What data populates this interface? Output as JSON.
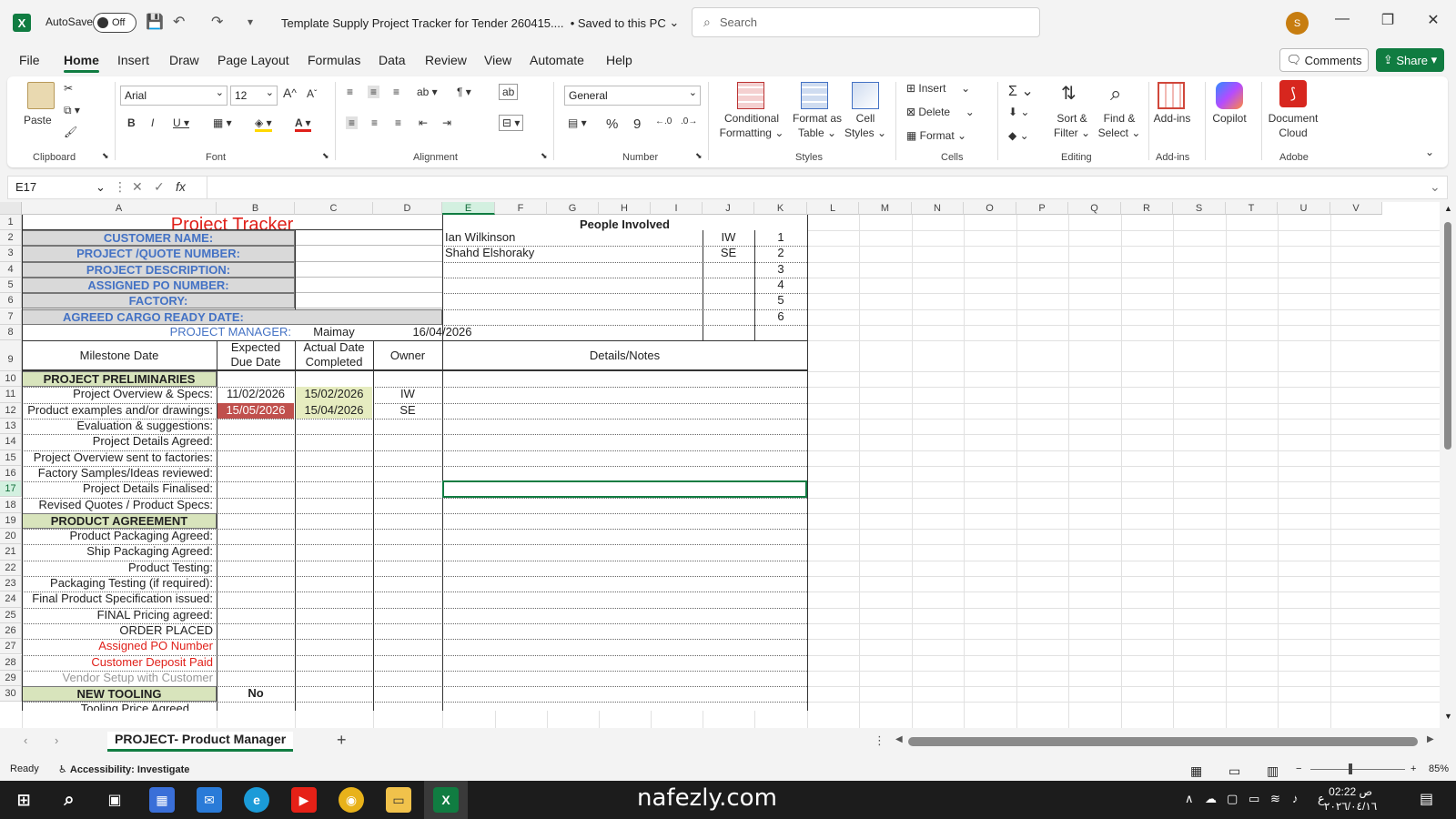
{
  "titlebar": {
    "app_icon": "X",
    "autosave_label": "AutoSave",
    "autosave_state": "Off",
    "doc_title": "Template Supply Project Tracker for Tender 260415....",
    "save_status": "• Saved to this PC",
    "search_placeholder": "Search",
    "user_initial": "S"
  },
  "menu": {
    "tabs": [
      "File",
      "Home",
      "Insert",
      "Draw",
      "Page Layout",
      "Formulas",
      "Data",
      "Review",
      "View",
      "Automate",
      "Help"
    ],
    "active": "Home",
    "comments": "Comments",
    "share": "Share"
  },
  "ribbon": {
    "clipboard": {
      "paste": "Paste",
      "label": "Clipboard"
    },
    "font": {
      "name": "Arial",
      "size": "12",
      "label": "Font"
    },
    "alignment": {
      "label": "Alignment"
    },
    "number": {
      "format": "General",
      "label": "Number"
    },
    "styles": {
      "conditional": "Conditional",
      "conditional2": "Formatting",
      "format_table": "Format as",
      "format_table2": "Table",
      "cell_styles": "Cell",
      "cell_styles2": "Styles",
      "label": "Styles"
    },
    "cells": {
      "insert": "Insert",
      "delete": "Delete",
      "format": "Format",
      "label": "Cells"
    },
    "editing": {
      "sort": "Sort &",
      "sort2": "Filter",
      "find": "Find &",
      "find2": "Select",
      "label": "Editing"
    },
    "addins": {
      "addins": "Add-ins",
      "label": "Add-ins"
    },
    "copilot": {
      "label": "Copilot"
    },
    "adobe": {
      "doc": "Document",
      "doc2": "Cloud",
      "label": "Adobe"
    }
  },
  "formula_bar": {
    "name_box": "E17",
    "fx": "fx",
    "content": ""
  },
  "grid": {
    "columns": [
      "A",
      "B",
      "C",
      "D",
      "E",
      "F",
      "G",
      "H",
      "I",
      "J",
      "K",
      "L",
      "M",
      "N",
      "O",
      "P",
      "Q",
      "R",
      "S",
      "T",
      "U",
      "V"
    ],
    "selected_column": "E",
    "selected_row": "17",
    "rows": [
      "1",
      "2",
      "3",
      "4",
      "5",
      "6",
      "7",
      "8",
      "9",
      "10",
      "11",
      "12",
      "13",
      "14",
      "15",
      "16",
      "17",
      "18",
      "19",
      "20",
      "21",
      "22",
      "23",
      "24",
      "25",
      "26",
      "27",
      "28",
      "29",
      "30"
    ]
  },
  "sheet": {
    "title": "Project Tracker",
    "people_header": "People Involved",
    "people": [
      {
        "name": "Ian Wilkinson",
        "initials": "IW",
        "num": "1"
      },
      {
        "name": "Shahd Elshoraky",
        "initials": "SE",
        "num": "2"
      },
      {
        "name": "",
        "initials": "",
        "num": "3"
      },
      {
        "name": "",
        "initials": "",
        "num": "4"
      },
      {
        "name": "",
        "initials": "",
        "num": "5"
      },
      {
        "name": "",
        "initials": "",
        "num": "6"
      }
    ],
    "labels": {
      "customer": "CUSTOMER NAME:",
      "project_quote": "PROJECT /QUOTE NUMBER:",
      "description": "PROJECT DESCRIPTION:",
      "po": "ASSIGNED PO NUMBER:",
      "factory": "FACTORY:",
      "cargo": "AGREED CARGO READY DATE:",
      "manager": "PROJECT MANAGER:",
      "manager_name": "Maimay",
      "manager_date": "16/04/2026"
    },
    "headers": {
      "milestone": "Milestone Date",
      "expected1": "Expected",
      "expected2": "Due Date",
      "actual1": "Actual Date",
      "actual2": "Completed",
      "owner": "Owner",
      "notes": "Details/Notes"
    },
    "milestones": [
      {
        "label": "PROJECT PRELIMINARIES",
        "kind": "section",
        "due": "",
        "done": "",
        "owner": ""
      },
      {
        "label": "Project Overview & Specs:",
        "kind": "item",
        "due": "11/02/2026",
        "done": "15/02/2026",
        "owner": "IW"
      },
      {
        "label": "Product examples and/or drawings:",
        "kind": "item",
        "due": "15/05/2026",
        "done": "15/04/2026",
        "owner": "SE"
      },
      {
        "label": "Evaluation & suggestions:",
        "kind": "item",
        "due": "",
        "done": "",
        "owner": ""
      },
      {
        "label": "Project Details Agreed:",
        "kind": "item",
        "due": "",
        "done": "",
        "owner": ""
      },
      {
        "label": "Project Overview sent to factories:",
        "kind": "item",
        "due": "",
        "done": "",
        "owner": ""
      },
      {
        "label": "Factory Samples/Ideas reviewed:",
        "kind": "item",
        "due": "",
        "done": "",
        "owner": ""
      },
      {
        "label": "Project Details Finalised:",
        "kind": "item",
        "due": "",
        "done": "",
        "owner": ""
      },
      {
        "label": "Revised Quotes / Product Specs:",
        "kind": "item",
        "due": "",
        "done": "",
        "owner": ""
      },
      {
        "label": "PRODUCT AGREEMENT",
        "kind": "section",
        "due": "",
        "done": "",
        "owner": ""
      },
      {
        "label": "Product Packaging Agreed:",
        "kind": "item",
        "due": "",
        "done": "",
        "owner": ""
      },
      {
        "label": "Ship Packaging Agreed:",
        "kind": "item",
        "due": "",
        "done": "",
        "owner": ""
      },
      {
        "label": "Product Testing:",
        "kind": "item",
        "due": "",
        "done": "",
        "owner": ""
      },
      {
        "label": "Packaging Testing (if required):",
        "kind": "item",
        "due": "",
        "done": "",
        "owner": ""
      },
      {
        "label": "Final Product Specification issued:",
        "kind": "item",
        "due": "",
        "done": "",
        "owner": ""
      },
      {
        "label": "FINAL Pricing agreed:",
        "kind": "item",
        "due": "",
        "done": "",
        "owner": ""
      },
      {
        "label": "ORDER PLACED",
        "kind": "item",
        "due": "",
        "done": "",
        "owner": ""
      },
      {
        "label": "Assigned PO Number",
        "kind": "red",
        "due": "",
        "done": "",
        "owner": ""
      },
      {
        "label": "Customer Deposit Paid",
        "kind": "red",
        "due": "",
        "done": "",
        "owner": ""
      },
      {
        "label": "Vendor Setup with Customer",
        "kind": "grey",
        "due": "",
        "done": "",
        "owner": ""
      },
      {
        "label": "NEW TOOLING",
        "kind": "section",
        "due": "No",
        "done": "",
        "owner": ""
      }
    ],
    "row31_partial": "Tooling Price Agreed"
  },
  "sheet_tabs": {
    "active": "PROJECT- Product Manager",
    "add": "+"
  },
  "status": {
    "ready": "Ready",
    "accessibility": "Accessibility: Investigate",
    "zoom": "85%"
  },
  "taskbar": {
    "watermark": "nafezly.com",
    "time": "02:22 ص",
    "date": "٢٠٢٦/٠٤/١٦",
    "lang": "ع"
  },
  "colors": {
    "excel_green": "#107c41",
    "label_blue": "#4472c4",
    "section_green": "#d8e4bc",
    "overdue_red": "#c0504d",
    "title_red": "#e0201a"
  }
}
